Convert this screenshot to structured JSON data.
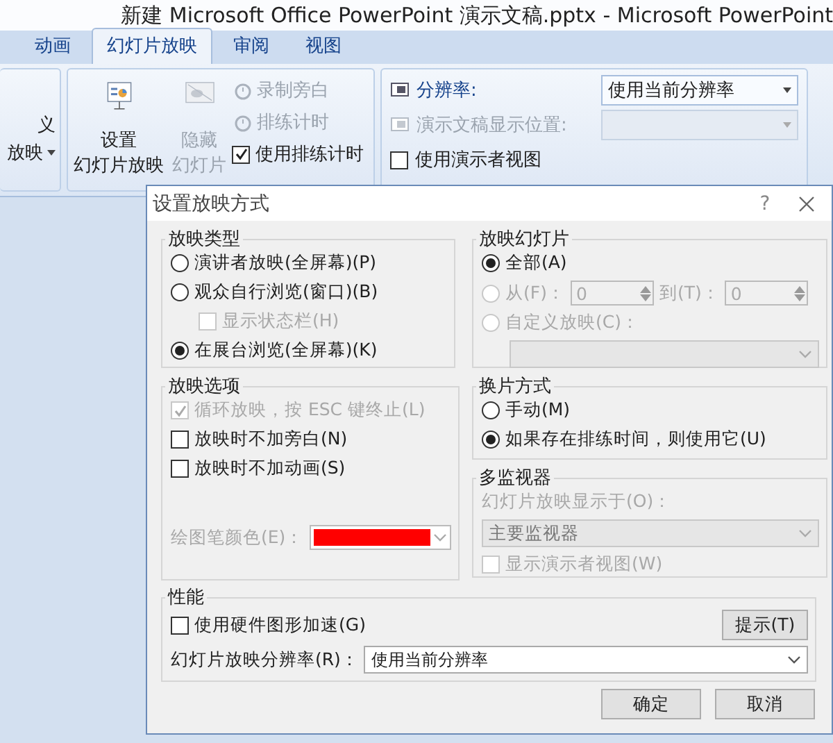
{
  "window": {
    "title": "新建 Microsoft Office PowerPoint 演示文稿.pptx - Microsoft PowerPoint"
  },
  "tabs": [
    {
      "label": "动画",
      "selected": false
    },
    {
      "label": "幻灯片放映",
      "selected": true
    },
    {
      "label": "审阅",
      "selected": false
    },
    {
      "label": "视图",
      "selected": false
    }
  ],
  "ribbon": {
    "cut_button": {
      "lines": [
        "义",
        "放映"
      ]
    },
    "setup_group": {
      "big_buttons": [
        {
          "lines": [
            "设置",
            "幻灯片放映"
          ],
          "disabled": false
        },
        {
          "lines": [
            "隐藏",
            "幻灯片"
          ],
          "disabled": true
        }
      ],
      "small_items": [
        {
          "kind": "button",
          "label": "录制旁白",
          "disabled": true
        },
        {
          "kind": "button",
          "label": "排练计时",
          "disabled": true
        },
        {
          "kind": "checkbox",
          "label": "使用排练计时",
          "checked": true,
          "disabled": false
        }
      ]
    },
    "monitors_group": {
      "resolution": {
        "label": "分辨率:",
        "value": "使用当前分辨率",
        "disabled": false
      },
      "show_on": {
        "label": "演示文稿显示位置:",
        "disabled": true
      },
      "presenter_view": {
        "label": "使用演示者视图",
        "checked": false
      }
    }
  },
  "dialog": {
    "title": "设置放映方式",
    "help": "?",
    "show_type": {
      "title": "放映类型",
      "options": [
        {
          "label": "演讲者放映(全屏幕)(P)",
          "selected": false
        },
        {
          "label": "观众自行浏览(窗口)(B)",
          "selected": false,
          "sub_option": {
            "label": "显示状态栏(H)",
            "checked": false,
            "disabled": true
          }
        },
        {
          "label": "在展台浏览(全屏幕)(K)",
          "selected": true
        }
      ]
    },
    "show_options": {
      "title": "放映选项",
      "options": [
        {
          "label": "循环放映，按 ESC 键终止(L)",
          "checked": true,
          "disabled": true
        },
        {
          "label": "放映时不加旁白(N)",
          "checked": false,
          "disabled": false
        },
        {
          "label": "放映时不加动画(S)",
          "checked": false,
          "disabled": false
        }
      ],
      "pen_color": {
        "label": "绘图笔颜色(E)：",
        "color": "#ff0000",
        "disabled": true
      }
    },
    "show_slides": {
      "title": "放映幻灯片",
      "options": [
        {
          "kind": "plain",
          "label": "全部(A)",
          "selected": true,
          "disabled": false
        },
        {
          "kind": "range",
          "label": "从(F)：",
          "selected": false,
          "disabled": true,
          "from": "0",
          "to_label": "到(T)：",
          "to": "0"
        },
        {
          "kind": "dropdown",
          "label": "自定义放映(C)：",
          "selected": false,
          "disabled": true
        }
      ]
    },
    "advance": {
      "title": "换片方式",
      "options": [
        {
          "label": "手动(M)",
          "selected": false
        },
        {
          "label": "如果存在排练时间，则使用它(U)",
          "selected": true
        }
      ]
    },
    "monitors": {
      "title": "多监视器",
      "disabled": true,
      "display_label": "幻灯片放映显示于(O)：",
      "display_value": "主要监视器",
      "presenter_view": {
        "label": "显示演示者视图(W)",
        "checked": false
      }
    },
    "performance": {
      "title": "性能",
      "hw_accel": {
        "label": "使用硬件图形加速(G)",
        "checked": false
      },
      "tips_button": "提示(T)",
      "resolution": {
        "label": "幻灯片放映分辨率(R)：",
        "value": "使用当前分辨率"
      }
    },
    "buttons": [
      "确定",
      "取消"
    ]
  }
}
